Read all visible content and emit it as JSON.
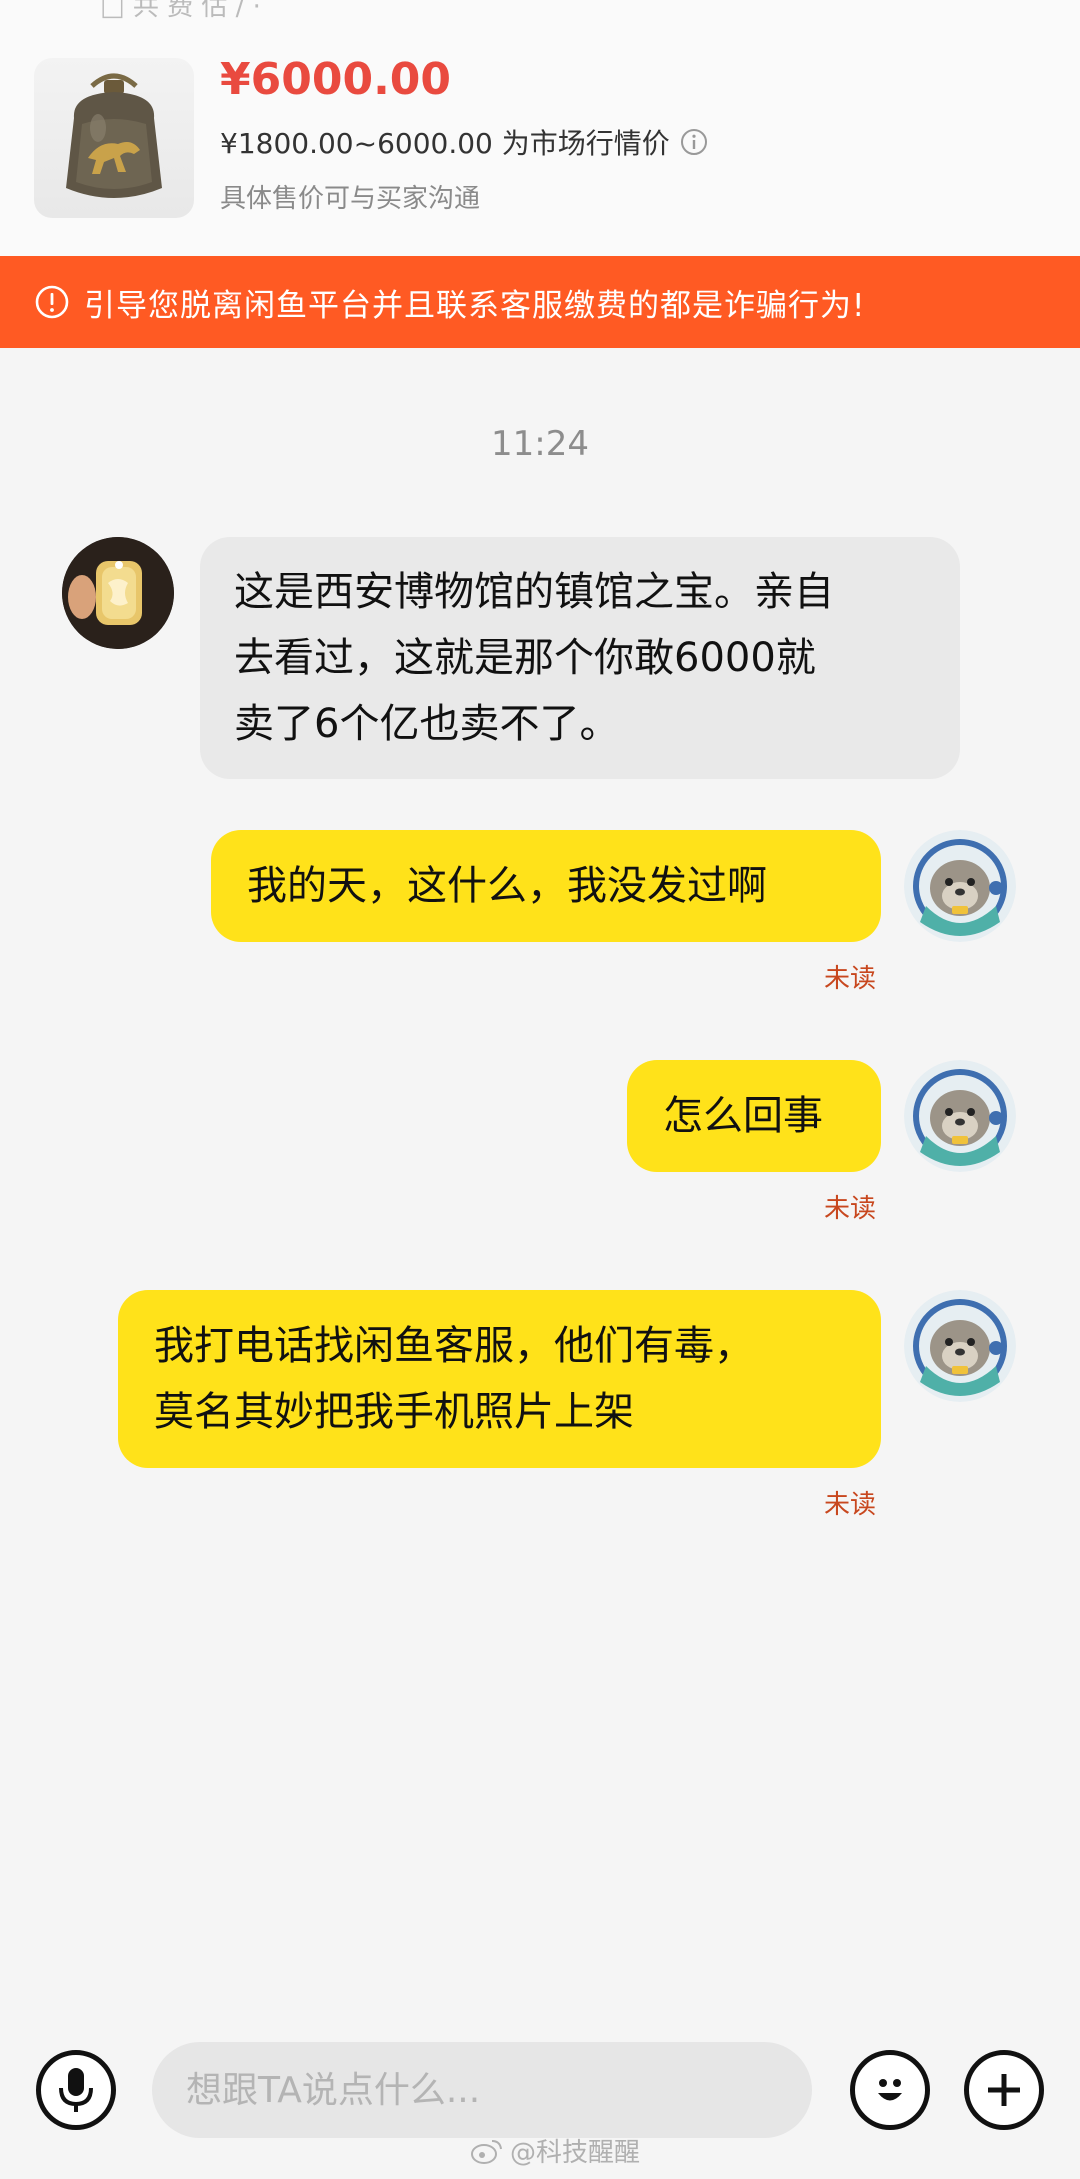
{
  "top_strip_text": "□ 共 费 估 / ·",
  "product": {
    "price": "¥6000.00",
    "market_range": "¥1800.00~6000.00 为市场行情价",
    "negotiable_note": "具体售价可与买家沟通"
  },
  "warning": {
    "text": "引导您脱离闲鱼平台并且联系客服缴费的都是诈骗行为!",
    "color": "#ff5a23"
  },
  "chat": {
    "timestamp": "11:24",
    "messages": [
      {
        "side": "in",
        "text": "这是西安博物馆的镇馆之宝。亲自\n去看过，这就是那个你敢6000就\n卖了6个亿也卖不了。"
      },
      {
        "side": "out",
        "text": "我的天，这什么，我没发过啊",
        "status": "未读"
      },
      {
        "side": "out",
        "text": "怎么回事",
        "status": "未读"
      },
      {
        "side": "out",
        "text": "我打电话找闲鱼客服，他们有毒，\n莫名其妙把我手机照片上架",
        "status": "未读"
      }
    ]
  },
  "input": {
    "placeholder": "想跟TA说点什么..."
  },
  "icons": {
    "voice": "microphone-icon",
    "emoji": "smiley-icon",
    "more": "plus-icon",
    "info": "info-icon",
    "warning": "exclamation-circle-icon"
  },
  "colors": {
    "accent_red": "#e94a3f",
    "bubble_out": "#ffe21a",
    "bubble_in": "#e9e9e9",
    "unread": "#c8471e"
  },
  "watermark": "@科技醒醒"
}
